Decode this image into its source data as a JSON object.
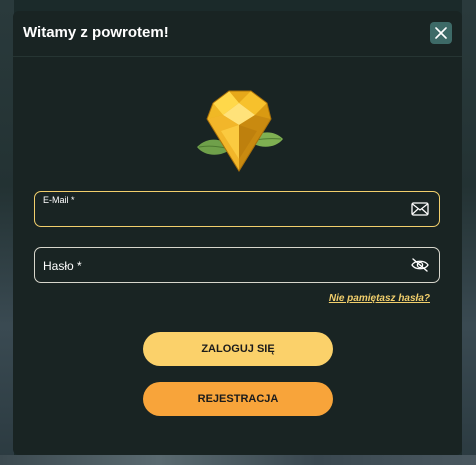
{
  "modal": {
    "title": "Witamy z powrotem!",
    "close_icon": "close-icon"
  },
  "logo": {
    "icon": "diamond-gem-icon"
  },
  "form": {
    "email": {
      "label": "E-Mail *",
      "value": "",
      "icon": "envelope-icon"
    },
    "password": {
      "label": "Hasło *",
      "value": "",
      "icon": "eye-slash-icon"
    },
    "forgot_link": "Nie pamiętasz hasła?"
  },
  "buttons": {
    "login_label": "ZALOGUJ SIĘ",
    "register_label": "REJESTRACJA"
  },
  "colors": {
    "modal_bg": "#192423",
    "accent_yellow": "#fbd16a",
    "accent_orange": "#f8a43a",
    "close_bg": "#3d6a67",
    "link": "#f2cf6c"
  }
}
